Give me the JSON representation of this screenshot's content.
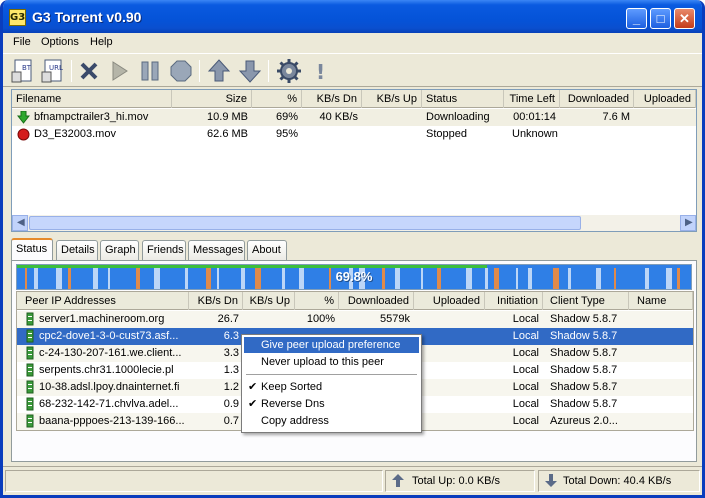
{
  "window": {
    "title": "G3 Torrent v0.90",
    "logo": "G3"
  },
  "menu": [
    "File",
    "Options",
    "Help"
  ],
  "toolbar": {
    "icons": [
      "new-torrent-icon",
      "url-torrent-icon",
      "remove-icon",
      "start-icon",
      "pause-icon",
      "stop-icon",
      "move-up-icon",
      "move-down-icon",
      "settings-icon",
      "info-icon"
    ],
    "new_label": "BT",
    "url_label": "URL",
    "info_glyph": "!"
  },
  "torrents": {
    "columns": [
      "Filename",
      "Size",
      "%",
      "KB/s Dn",
      "KB/s Up",
      "Status",
      "Time Left",
      "Downloaded",
      "Uploaded"
    ],
    "rows": [
      {
        "name": "bfnampctrailer3_hi.mov",
        "size": "10.9 MB",
        "pct": "69%",
        "dn": "40 KB/s",
        "up": "",
        "status": "Downloading",
        "time": "00:01:14",
        "downloaded": "7.6 M",
        "uploaded": "",
        "icon": "down-arrow-icon"
      },
      {
        "name": "D3_E32003.mov",
        "size": "62.6 MB",
        "pct": "95%",
        "dn": "",
        "up": "",
        "status": "Stopped",
        "time": "Unknown",
        "downloaded": "",
        "uploaded": "",
        "icon": "stopped-icon"
      }
    ]
  },
  "tabs": [
    "Status",
    "Details",
    "Graph",
    "Friends",
    "Messages",
    "About"
  ],
  "progress": {
    "label": "69.8%",
    "value": 0.698
  },
  "peers": {
    "columns": [
      "Peer IP Addresses",
      "KB/s Dn",
      "KB/s Up",
      "%",
      "Downloaded",
      "Uploaded",
      "Initiation",
      "Client Type",
      "Name"
    ],
    "rows": [
      {
        "ip": "server1.machineroom.org",
        "dn": "26.7",
        "up": "",
        "pct": "100%",
        "downloaded": "5579k",
        "uploaded": "",
        "init": "Local",
        "client": "Shadow 5.8.7",
        "name": ""
      },
      {
        "ip": "cpc2-dove1-3-0-cust73.asf...",
        "dn": "6.3",
        "up": "",
        "pct": "",
        "downloaded": "",
        "uploaded": "",
        "init": "Local",
        "client": "Shadow 5.8.7",
        "name": "",
        "selected": true
      },
      {
        "ip": "c-24-130-207-161.we.client...",
        "dn": "3.3",
        "up": "",
        "pct": "",
        "downloaded": "",
        "uploaded": "",
        "init": "Local",
        "client": "Shadow 5.8.7",
        "name": ""
      },
      {
        "ip": "serpents.chr31.1000lecie.pl",
        "dn": "1.3",
        "up": "",
        "pct": "",
        "downloaded": "",
        "uploaded": "",
        "init": "Local",
        "client": "Shadow 5.8.7",
        "name": ""
      },
      {
        "ip": "10-38.adsl.lpoy.dnainternet.fi",
        "dn": "1.2",
        "up": "",
        "pct": "",
        "downloaded": "",
        "uploaded": "",
        "init": "Local",
        "client": "Shadow 5.8.7",
        "name": ""
      },
      {
        "ip": "68-232-142-71.chvlva.adel...",
        "dn": "0.9",
        "up": "",
        "pct": "",
        "downloaded": "",
        "uploaded": "",
        "init": "Local",
        "client": "Shadow 5.8.7",
        "name": ""
      },
      {
        "ip": "baana-pppoes-213-139-166...",
        "dn": "0.7",
        "up": "",
        "pct": "",
        "downloaded": "",
        "uploaded": "",
        "init": "Local",
        "client": "Azureus 2.0...",
        "name": ""
      }
    ]
  },
  "context_menu": {
    "items": [
      {
        "label": "Give peer upload preference",
        "highlighted": true,
        "checked": false
      },
      {
        "label": "Never upload to this peer",
        "highlighted": false,
        "checked": false
      },
      {
        "label": "Keep Sorted",
        "highlighted": false,
        "checked": true
      },
      {
        "label": "Reverse Dns",
        "highlighted": false,
        "checked": true
      },
      {
        "label": "Copy address",
        "highlighted": false,
        "checked": false
      }
    ],
    "check_glyph": "✔"
  },
  "status": {
    "total_up": "Total Up: 0.0 KB/s",
    "total_down": "Total Down: 40.4 KB/s"
  },
  "colors": {
    "accent": "#316ac5",
    "progress_blue": "#2f7fe6",
    "progress_orange": "#e08a4a",
    "titlebar": "#0553d8"
  }
}
